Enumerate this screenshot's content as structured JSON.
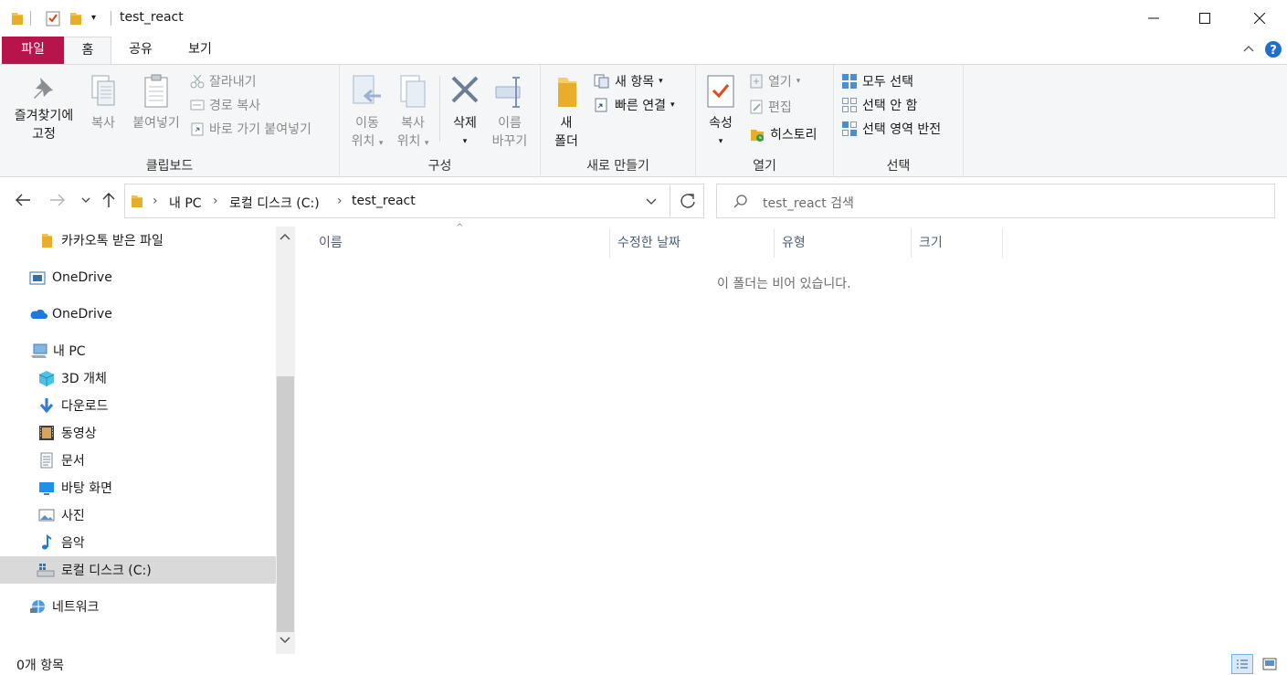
{
  "window": {
    "title": "test_react"
  },
  "tabs": {
    "file": "파일",
    "home": "홈",
    "share": "공유",
    "view": "보기"
  },
  "ribbon": {
    "clipboard": {
      "label": "클립보드",
      "pin_line1": "즐겨찾기에",
      "pin_line2": "고정",
      "copy": "복사",
      "paste": "붙여넣기",
      "cut": "잘라내기",
      "copy_path": "경로 복사",
      "paste_shortcut": "바로 가기 붙여넣기"
    },
    "organize": {
      "label": "구성",
      "move_line1": "이동",
      "move_line2": "위치",
      "copyto_line1": "복사",
      "copyto_line2": "위치",
      "delete": "삭제",
      "rename_line1": "이름",
      "rename_line2": "바꾸기"
    },
    "new": {
      "label": "새로 만들기",
      "folder_line1": "새",
      "folder_line2": "폴더",
      "new_item": "새 항목",
      "easy_access": "빠른 연결"
    },
    "open": {
      "label": "열기",
      "properties": "속성",
      "open": "열기",
      "edit": "편집",
      "history": "히스토리"
    },
    "select": {
      "label": "선택",
      "select_all": "모두 선택",
      "select_none": "선택 안 함",
      "invert": "선택 영역 반전"
    }
  },
  "address": {
    "crumbs": [
      "내 PC",
      "로컬 디스크 (C:)",
      "test_react"
    ],
    "search_placeholder": "test_react 검색"
  },
  "nav": {
    "items": [
      {
        "label": "카카오톡 받은 파일",
        "icon": "folder-icon"
      },
      {
        "label": "OneDrive",
        "icon": "onedrive-business-icon"
      },
      {
        "label": "OneDrive",
        "icon": "onedrive-cloud-icon"
      },
      {
        "label": "내 PC",
        "icon": "pc-icon"
      },
      {
        "label": "3D 개체",
        "icon": "3d-objects-icon"
      },
      {
        "label": "다운로드",
        "icon": "download-icon"
      },
      {
        "label": "동영상",
        "icon": "video-icon"
      },
      {
        "label": "문서",
        "icon": "document-icon"
      },
      {
        "label": "바탕 화면",
        "icon": "desktop-icon"
      },
      {
        "label": "사진",
        "icon": "pictures-icon"
      },
      {
        "label": "음악",
        "icon": "music-icon"
      },
      {
        "label": "로컬 디스크 (C:)",
        "icon": "drive-icon"
      },
      {
        "label": "네트워크",
        "icon": "network-icon"
      }
    ],
    "selected": "로컬 디스크 (C:)"
  },
  "content": {
    "columns": [
      "이름",
      "수정한 날짜",
      "유형",
      "크기"
    ],
    "empty_message": "이 폴더는 비어 있습니다."
  },
  "status": {
    "item_count": "0개 항목"
  },
  "colors": {
    "file_tab": "#b8144c",
    "ribbon_bg": "#f5f6f7",
    "selected_nav": "#d9d9d9"
  }
}
